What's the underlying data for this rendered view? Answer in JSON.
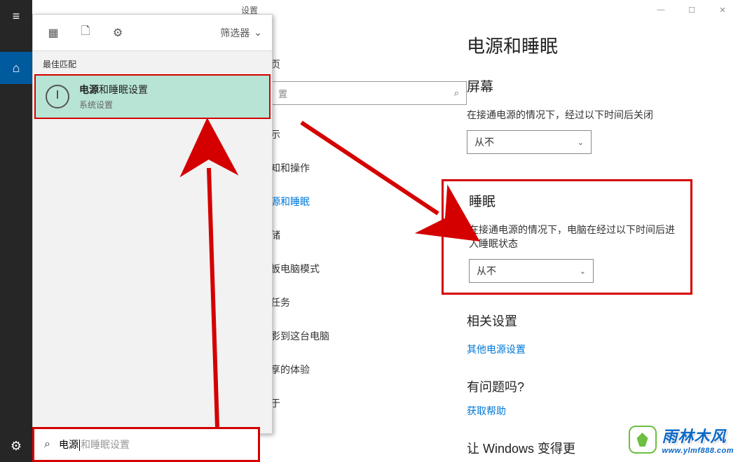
{
  "window": {
    "title": "设置"
  },
  "start": {
    "filter": "筛选器",
    "best_match_label": "最佳匹配",
    "result": {
      "title_bold": "电源",
      "title_rest": "和睡眠设置",
      "subtitle": "系统设置"
    },
    "search": {
      "typed": "电源",
      "ghost": "和睡眠设置"
    }
  },
  "nav": {
    "search_placeholder": "置",
    "items": [
      "页",
      "示",
      "知和操作",
      "源和睡眠",
      "储",
      "板电脑模式",
      "任务",
      "影到这台电脑",
      "享的体验",
      "于"
    ],
    "active_index": 3
  },
  "content": {
    "page_title": "电源和睡眠",
    "screen": {
      "title": "屏幕",
      "desc": "在接通电源的情况下，经过以下时间后关闭",
      "value": "从不"
    },
    "sleep": {
      "title": "睡眠",
      "desc": "在接通电源的情况下，电脑在经过以下时间后进入睡眠状态",
      "value": "从不"
    },
    "related": {
      "title": "相关设置",
      "link": "其他电源设置"
    },
    "help": {
      "title": "有问题吗?",
      "link": "获取帮助"
    },
    "better": "让 Windows 变得更"
  },
  "watermark": {
    "main": "雨林木风",
    "url": "www.ylmf888.com"
  }
}
